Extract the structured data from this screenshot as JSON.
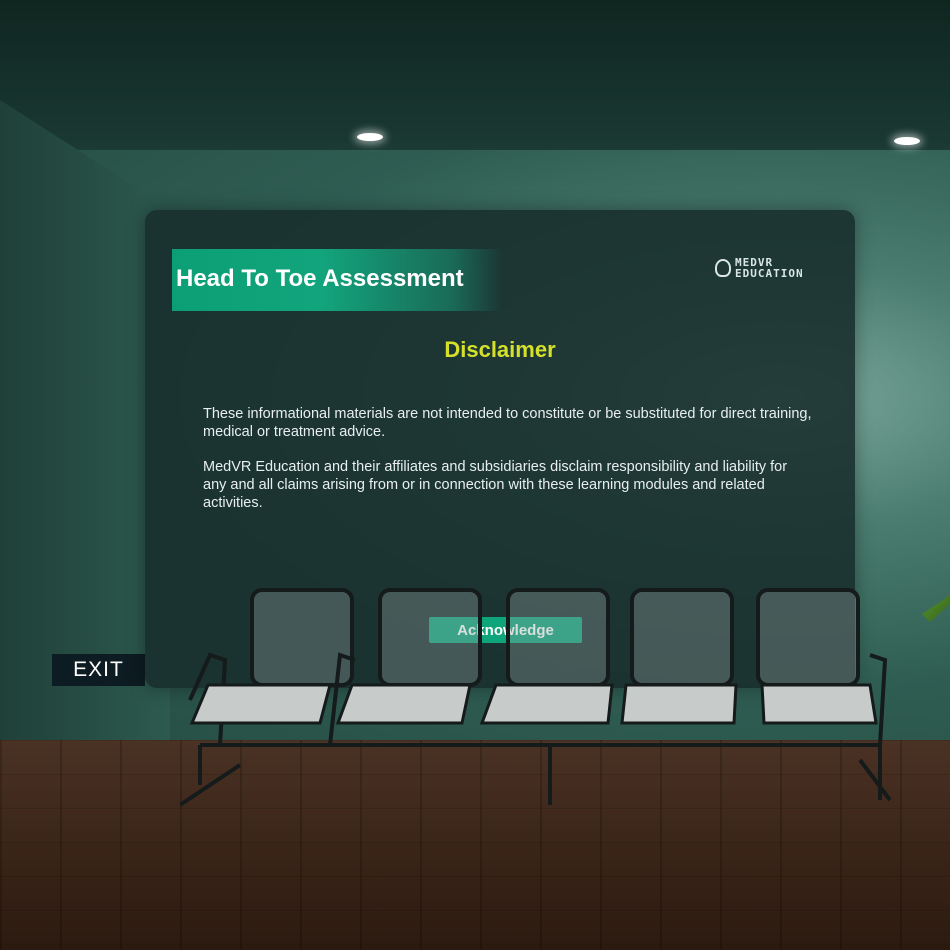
{
  "scene": {
    "exit_sign": "EXIT"
  },
  "panel": {
    "title": "Head To Toe Assessment",
    "logo": {
      "line1": "MEDVR",
      "line2": "EDUCATION",
      "icon": "vr-headset-icon"
    },
    "heading": "Disclaimer",
    "paragraphs": [
      "These informational materials are not intended to constitute or be substituted for direct training, medical or treatment advice.",
      "MedVR Education and their affiliates and subsidiaries disclaim responsibility and liability for any and all claims arising from or in connection with these learning modules and related activities."
    ],
    "button_label": "Acknowledge"
  },
  "colors": {
    "accent_green": "#0ea57b",
    "heading_yellow": "#d4e02a",
    "panel_bg": "#182e2c"
  }
}
